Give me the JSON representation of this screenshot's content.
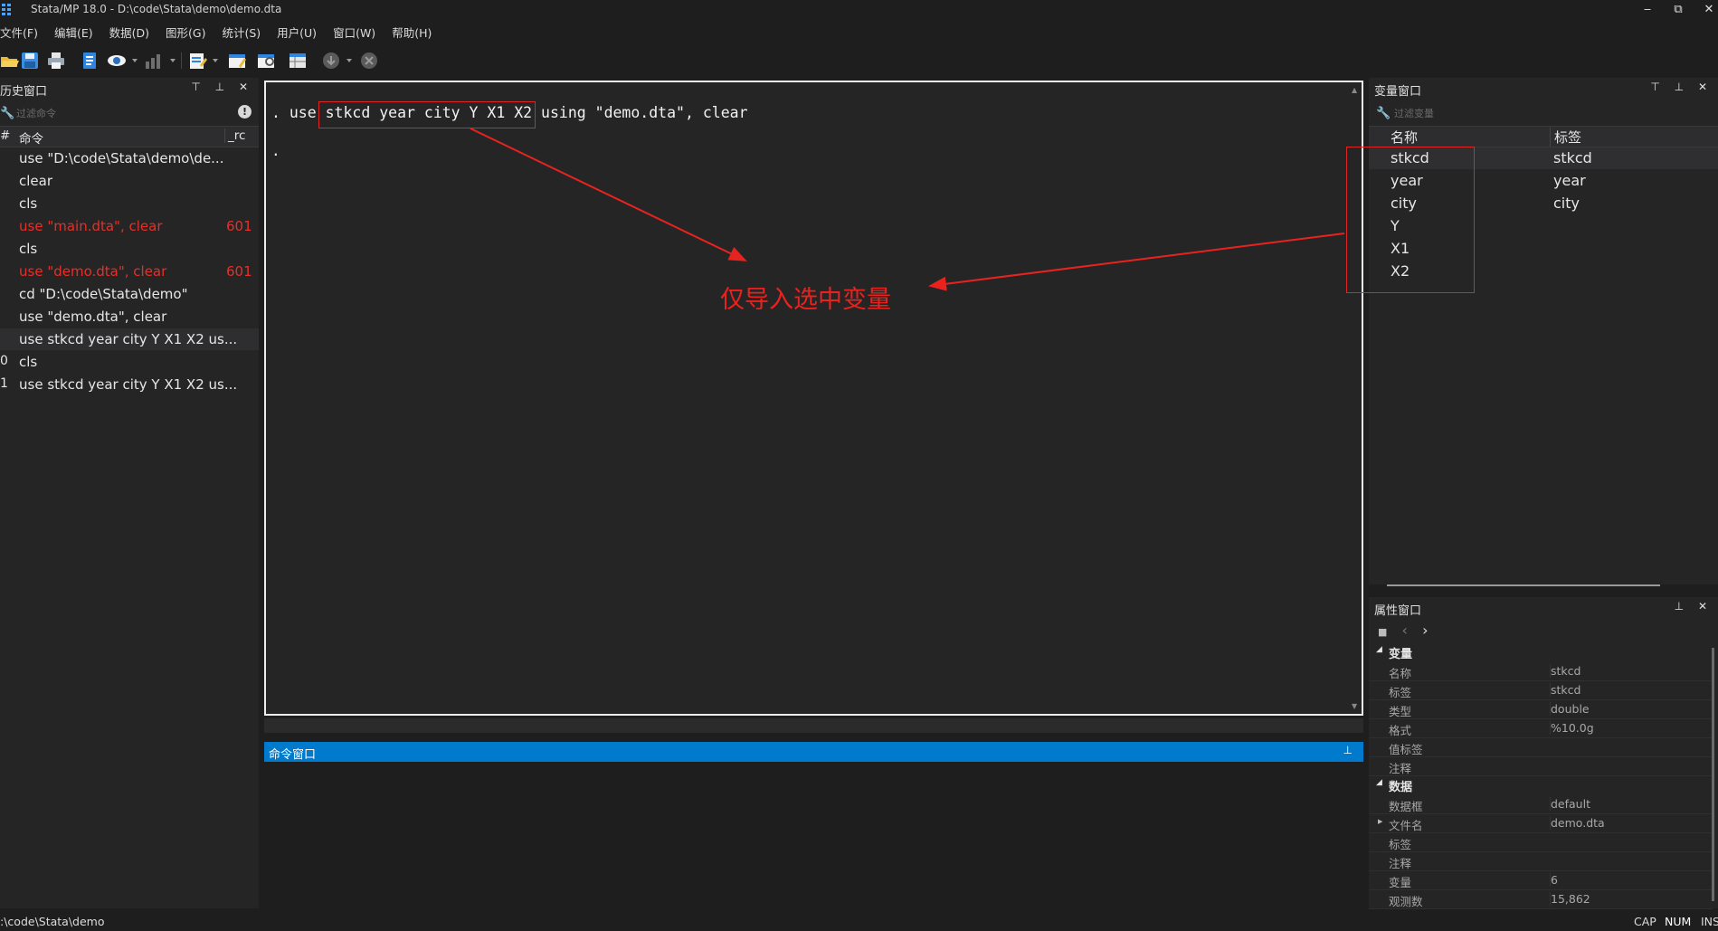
{
  "window": {
    "title": "Stata/MP 18.0 - D:\\code\\Stata\\demo\\demo.dta",
    "controls": [
      "‒",
      "⧉",
      "✕"
    ]
  },
  "menubar": [
    "文件(F)",
    "编辑(E)",
    "数据(D)",
    "图形(G)",
    "统计(S)",
    "用户(U)",
    "窗口(W)",
    "帮助(H)"
  ],
  "toolbar": {
    "icons": [
      "open-icon",
      "save-icon",
      "print-icon",
      "log-icon",
      "viewer-icon",
      "graph-icon",
      "do-file-editor-icon",
      "data-editor-icon",
      "data-browser-icon",
      "variables-manager-icon",
      "more-icon",
      "break-icon"
    ]
  },
  "history": {
    "title": "历史窗口",
    "controls": "⊤ ⊥ ✕",
    "filter_placeholder": "过滤命令",
    "info_icon": "!",
    "columns": {
      "num": "#",
      "cmd": "命令",
      "rc": "_rc"
    },
    "rows": [
      {
        "num": "",
        "cmd": "use \"D:\\code\\Stata\\demo\\de...",
        "rc": "",
        "error": false
      },
      {
        "num": "",
        "cmd": "clear",
        "rc": "",
        "error": false
      },
      {
        "num": "",
        "cmd": "cls",
        "rc": "",
        "error": false
      },
      {
        "num": "",
        "cmd": "use \"main.dta\", clear",
        "rc": "601",
        "error": true
      },
      {
        "num": "",
        "cmd": "cls",
        "rc": "",
        "error": false
      },
      {
        "num": "",
        "cmd": "use \"demo.dta\", clear",
        "rc": "601",
        "error": true
      },
      {
        "num": "",
        "cmd": "cd \"D:\\code\\Stata\\demo\"",
        "rc": "",
        "error": false
      },
      {
        "num": "",
        "cmd": "use \"demo.dta\", clear",
        "rc": "",
        "error": false
      },
      {
        "num": "",
        "cmd": "use stkcd year city Y X1 X2 us...",
        "rc": "",
        "error": false
      },
      {
        "num": "0",
        "cmd": "cls",
        "rc": "",
        "error": false
      },
      {
        "num": "1",
        "cmd": "use stkcd year city Y X1 X2 us...",
        "rc": "",
        "error": false
      }
    ]
  },
  "results": {
    "line1_prefix": ". use ",
    "line1_highlight": "stkcd year city Y X1 X2",
    "line1_suffix": " using \"demo.dta\", clear",
    "line2": "."
  },
  "command_window": {
    "title": "命令窗口",
    "pin": "📌"
  },
  "variables": {
    "title": "变量窗口",
    "controls": "⊤ ⊥ ✕",
    "filter_placeholder": "过滤变量",
    "columns": {
      "name": "名称",
      "label": "标签"
    },
    "rows": [
      {
        "name": "stkcd",
        "label": "stkcd"
      },
      {
        "name": "year",
        "label": "year"
      },
      {
        "name": "city",
        "label": "city"
      },
      {
        "name": "Y",
        "label": ""
      },
      {
        "name": "X1",
        "label": ""
      },
      {
        "name": "X2",
        "label": ""
      }
    ]
  },
  "properties": {
    "title": "属性窗口",
    "controls": "⊥ ✕",
    "nav": {
      "lock": "🔒",
      "back": "‹",
      "fwd": "›"
    },
    "sections": [
      {
        "name": "变量",
        "rows": [
          {
            "k": "名称",
            "v": "stkcd"
          },
          {
            "k": "标签",
            "v": "stkcd"
          },
          {
            "k": "类型",
            "v": "double"
          },
          {
            "k": "格式",
            "v": "%10.0g"
          },
          {
            "k": "值标签",
            "v": ""
          },
          {
            "k": "注释",
            "v": ""
          }
        ]
      },
      {
        "name": "数据",
        "rows": [
          {
            "k": "数据框",
            "v": "default"
          },
          {
            "k": "文件名",
            "v": "demo.dta"
          },
          {
            "k": "标签",
            "v": ""
          },
          {
            "k": "注释",
            "v": ""
          },
          {
            "k": "变量",
            "v": "6"
          },
          {
            "k": "观测数",
            "v": "15,862"
          }
        ]
      }
    ]
  },
  "statusbar": {
    "path": ":\\code\\Stata\\demo",
    "cap": "CAP",
    "num": "NUM",
    "ins": "INS"
  },
  "annotation": {
    "text": "仅导入选中变量",
    "color": "#e8231f"
  }
}
